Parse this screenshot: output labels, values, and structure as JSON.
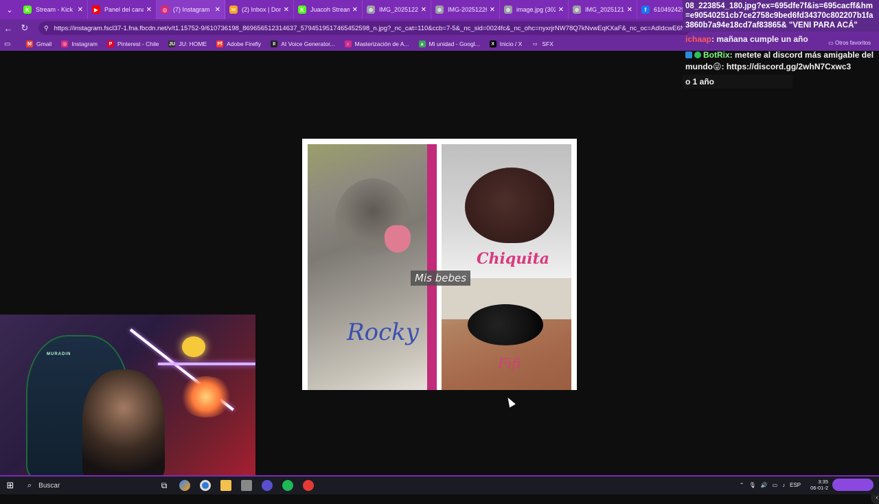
{
  "browser": {
    "tabs": [
      {
        "title": "Stream - Kick Dash",
        "icon_color": "#53fc18",
        "icon_glyph": "K"
      },
      {
        "title": "Panel del canal - Y",
        "icon_color": "#ff0000",
        "icon_glyph": "▶"
      },
      {
        "title": "(7) Instagram",
        "icon_color": "#d62976",
        "icon_glyph": "◎"
      },
      {
        "title": "(2) Inbox | Donoc",
        "icon_color": "#f5a623",
        "icon_glyph": "✉"
      },
      {
        "title": "Juacoh Stream - V",
        "icon_color": "#53fc18",
        "icon_glyph": "K"
      },
      {
        "title": "IMG_20251221_1",
        "icon_color": "#9aa0a6",
        "icon_glyph": "⊕"
      },
      {
        "title": "IMG-20251226-W",
        "icon_color": "#9aa0a6",
        "icon_glyph": "⊕"
      },
      {
        "title": "image.jpg (3024",
        "icon_color": "#9aa0a6",
        "icon_glyph": "⊕"
      },
      {
        "title": "IMG_20251211_0",
        "icon_color": "#9aa0a6",
        "icon_glyph": "⊕"
      },
      {
        "title": "610492429",
        "icon_color": "#1877f2",
        "icon_glyph": "f"
      }
    ],
    "address": "https://instagram.fscl37-1.fna.fbcdn.net/v/t1.15752-9/610736198_869656512314637_5794519517465452598_n.jpg?_nc_cat=110&ccb=7-5&_nc_sid=0024fc&_nc_ohc=nyxrjrNW78Q7kNvwEqKXaF&_nc_oc=AdIdcwE6NjF7wkETrr...",
    "bookmarks": [
      {
        "label": "Gmail",
        "icon_color": "#ea4335",
        "icon_glyph": "M"
      },
      {
        "label": "Instagram",
        "icon_color": "#d62976",
        "icon_glyph": "◎"
      },
      {
        "label": "Pinterest - Chile",
        "icon_color": "#e60023",
        "icon_glyph": "P"
      },
      {
        "label": "JU: HOME",
        "icon_color": "#333333",
        "icon_glyph": "JU"
      },
      {
        "label": "Adobe Firefly",
        "icon_color": "#ff3c2e",
        "icon_glyph": "Ff"
      },
      {
        "label": "AI Voice Generator...",
        "icon_color": "#222222",
        "icon_glyph": "II"
      },
      {
        "label": "Masterización de A...",
        "icon_color": "#d12c8c",
        "icon_glyph": "♪"
      },
      {
        "label": "Mi unidad - Googl...",
        "icon_color": "#34a853",
        "icon_glyph": "▲"
      },
      {
        "label": "Inicio / X",
        "icon_color": "#000000",
        "icon_glyph": "X"
      },
      {
        "label": "SFX",
        "icon_color": "#6a2a9c",
        "icon_glyph": "▭"
      }
    ],
    "other_bookmarks": "Otros favoritos"
  },
  "image": {
    "caption": "Mis bebes",
    "names": {
      "rocky": "Rocky",
      "chiquita": "Chiquita",
      "fifi": "Fifi"
    }
  },
  "chat": {
    "top_lines": "08_223854_180.jpg?ex=695dfe7f&is=695cacff&hm=e90540251cb7ce2758c9bed6fd34370c802207b1fa3860b7a94e18cd7af83865& \"VENI PARA ACÁ\"",
    "messages": [
      {
        "user": "ichaap",
        "text": ": mañana cumple un año"
      },
      {
        "user": "BotRix",
        "text": ": metete al discord más amigable del mundo😜: https://discord.gg/2whN7Cxwc3"
      }
    ],
    "tail": "o 1 año"
  },
  "webcam": {
    "chair_brand": "MURADIN"
  },
  "taskbar": {
    "search_placeholder": "Buscar",
    "language": "ESP",
    "time": "3:35",
    "date": "06-01-2"
  }
}
